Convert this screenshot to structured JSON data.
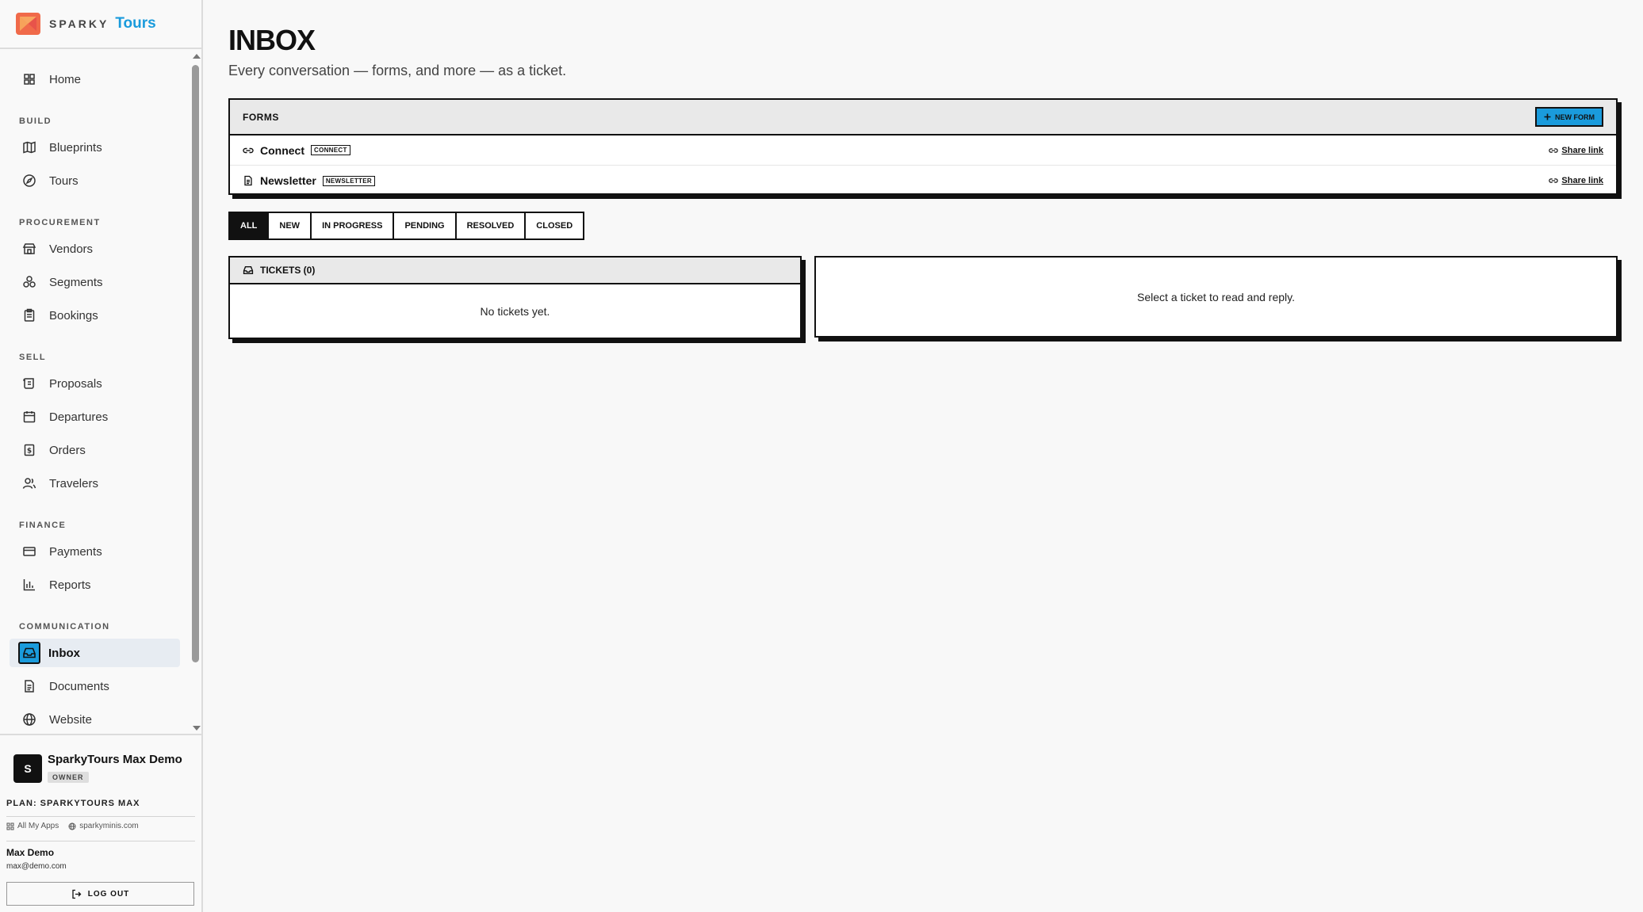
{
  "brand": {
    "sparky": "SPARKY",
    "tours": "Tours"
  },
  "nav": {
    "home": "Home",
    "sections": {
      "build": "BUILD",
      "procurement": "PROCUREMENT",
      "sell": "SELL",
      "finance": "FINANCE",
      "communication": "COMMUNICATION"
    },
    "items": {
      "blueprints": "Blueprints",
      "tours": "Tours",
      "vendors": "Vendors",
      "segments": "Segments",
      "bookings": "Bookings",
      "proposals": "Proposals",
      "departures": "Departures",
      "orders": "Orders",
      "travelers": "Travelers",
      "payments": "Payments",
      "reports": "Reports",
      "inbox": "Inbox",
      "documents": "Documents",
      "website": "Website"
    },
    "active": "Inbox"
  },
  "footer": {
    "org_initial": "S",
    "org_name": "SparkyTours Max Demo",
    "role": "OWNER",
    "plan": "PLAN: SPARKYTOURS MAX",
    "all_apps": "All My Apps",
    "domain": "sparkyminis.com",
    "user_name": "Max Demo",
    "user_email": "max@demo.com",
    "logout": "LOG OUT"
  },
  "page": {
    "title": "INBOX",
    "subtitle": "Every conversation — forms, and more — as a ticket."
  },
  "forms": {
    "title": "FORMS",
    "new_form": "NEW FORM",
    "rows": [
      {
        "name": "Connect",
        "tag": "CONNECT",
        "share": "Share link",
        "icon": "link-icon"
      },
      {
        "name": "Newsletter",
        "tag": "NEWSLETTER",
        "share": "Share link",
        "icon": "document-icon"
      }
    ]
  },
  "filters": [
    "ALL",
    "NEW",
    "IN PROGRESS",
    "PENDING",
    "RESOLVED",
    "CLOSED"
  ],
  "filter_active": "ALL",
  "tickets": {
    "title": "TICKETS (0)",
    "empty": "No tickets yet."
  },
  "reader": {
    "empty": "Select a ticket to read and reply."
  },
  "colors": {
    "accent": "#1a9bdc",
    "ink": "#111111",
    "background": "#f8f8f8"
  }
}
